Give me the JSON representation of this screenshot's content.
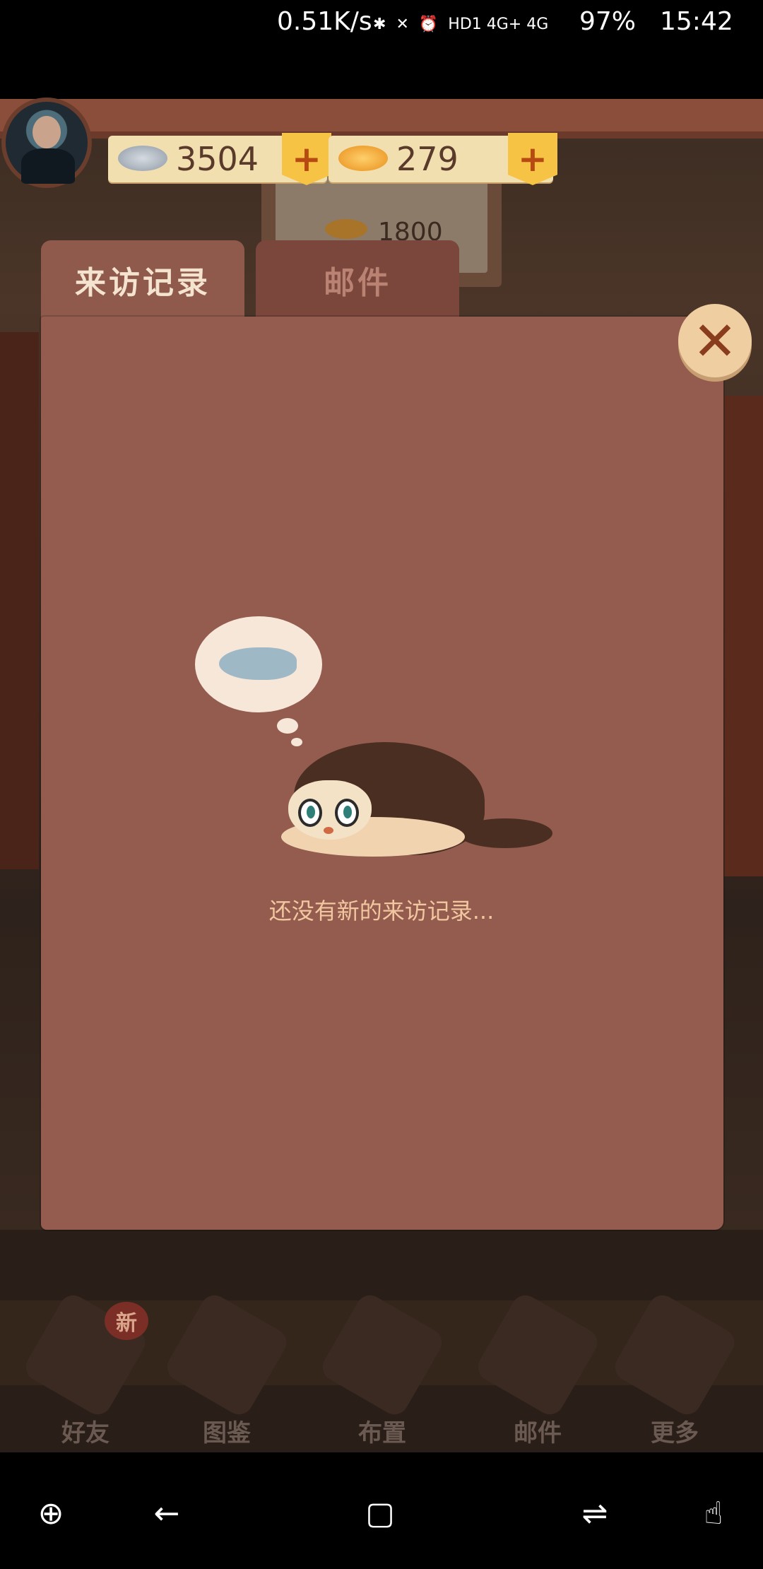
{
  "status_bar": {
    "speed": "0.51K/s",
    "network": "HD1 4G+ 4G",
    "battery": "97%",
    "time": "15:42",
    "icons": [
      "bluetooth-icon",
      "mute-icon",
      "alarm-icon",
      "hd-icon",
      "signal-icon",
      "battery-icon"
    ]
  },
  "hud": {
    "silver_fish": "3504",
    "gold_fish": "279",
    "plus_label": "+"
  },
  "background_sign": {
    "price": "1800"
  },
  "dialog": {
    "tabs": [
      {
        "label": "来访记录",
        "active": true
      },
      {
        "label": "邮件",
        "active": false
      }
    ],
    "close_label": "✕",
    "empty_message": "还没有新的来访记录..."
  },
  "bottom_menu": {
    "items": [
      {
        "label": "好友"
      },
      {
        "label": "图鉴"
      },
      {
        "label": "布置"
      },
      {
        "label": "邮件"
      },
      {
        "label": "更多"
      }
    ],
    "new_badge": "新"
  },
  "nav_bar": {
    "icons": [
      "game-tools-icon",
      "back-icon",
      "home-icon",
      "recent-apps-icon",
      "touch-assist-icon"
    ]
  },
  "colors": {
    "panel": "#935c4f",
    "active_tab": "#8f5a4c",
    "inactive_tab": "#7b463b",
    "message_text": "#f2c7a0",
    "currency_bg": "#f2dfb0",
    "plus_button": "#f6c344"
  }
}
